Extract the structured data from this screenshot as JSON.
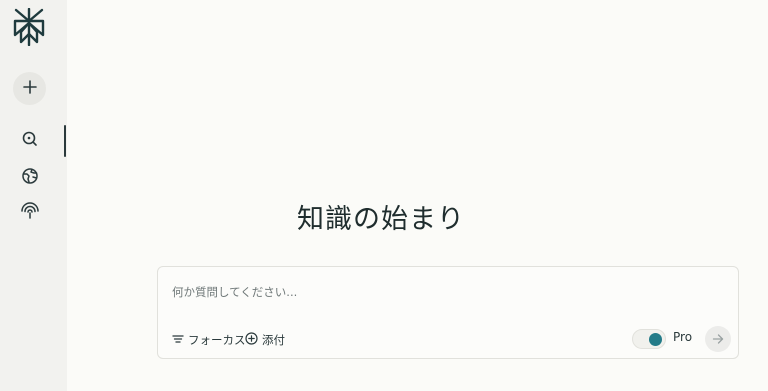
{
  "sidebar": {
    "logo_icon": "perplexity-logo-icon",
    "new_thread_icon": "plus-icon",
    "nav": [
      {
        "id": "discover",
        "icon": "search-icon",
        "active": true
      },
      {
        "id": "explore",
        "icon": "globe-icon",
        "active": false
      },
      {
        "id": "spaces",
        "icon": "signal-icon",
        "active": false
      }
    ]
  },
  "main": {
    "headline": "知識の始まり",
    "ask": {
      "placeholder": "何か質問してください...",
      "focus_label": "フォーカス",
      "attach_label": "添付",
      "pro_label": "Pro",
      "pro_enabled": true
    }
  },
  "colors": {
    "accent": "#237b88",
    "sidebar_bg": "#f2f2ef",
    "page_bg": "#fbfbf8",
    "text": "#1f2d2e"
  }
}
